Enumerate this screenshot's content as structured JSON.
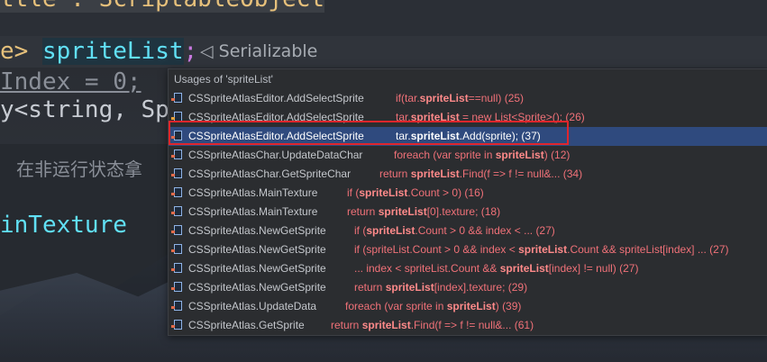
{
  "editor": {
    "line1": "ttle : ScriptableObject",
    "line2_kw": "e> ",
    "line2_ident": "spriteList",
    "line2_semi": ";",
    "serializable": "Serializable",
    "line3": "Index = 0;",
    "line4_gen": "y<string, Spr",
    "comment": "在非运行状态拿",
    "line5": "inTexture",
    "line6": "..."
  },
  "popup": {
    "header": "Usages of 'spriteList'",
    "rows": [
      {
        "location": "CSSpriteAtlasEditor.AddSelectSprite",
        "pre": "if(tar.",
        "hit": "spriteList",
        "post": "==null) (25)",
        "selected": false
      },
      {
        "location": "CSSpriteAtlasEditor.AddSelectSprite",
        "pre": "tar.",
        "hit": "spriteList",
        "post": " = new List<Sprite>(); (26)",
        "selected": false
      },
      {
        "location": "CSSpriteAtlasEditor.AddSelectSprite",
        "pre": "tar.",
        "hit": "spriteList",
        "post": ".Add(sprite); (37)",
        "selected": true
      },
      {
        "location": "CSSpriteAtlasChar.UpdateDataChar",
        "pre": "foreach (var sprite in ",
        "hit": "spriteList",
        "post": ") (12)",
        "selected": false
      },
      {
        "location": "CSSpriteAtlasChar.GetSpriteChar",
        "pre": "return ",
        "hit": "spriteList",
        "post": ".Find(f => f != null&... (34)",
        "selected": false
      },
      {
        "location": "CSSpriteAtlas.MainTexture",
        "pre": "if (",
        "hit": "spriteList",
        "post": ".Count > 0) (16)",
        "selected": false
      },
      {
        "location": "CSSpriteAtlas.MainTexture",
        "pre": "return ",
        "hit": "spriteList",
        "post": "[0].texture; (18)",
        "selected": false
      },
      {
        "location": "CSSpriteAtlas.NewGetSprite",
        "pre": "if (",
        "hit": "spriteList",
        "post": ".Count > 0 && index < ... (27)",
        "selected": false
      },
      {
        "location": "CSSpriteAtlas.NewGetSprite",
        "pre": "if (spriteList.Count > 0 && index < ",
        "hit": "spriteList",
        "post": ".Count && spriteList[index] ... (27)",
        "selected": false
      },
      {
        "location": "CSSpriteAtlas.NewGetSprite",
        "pre": "... index < spriteList.Count && ",
        "hit": "spriteList",
        "post": "[index] != null) (27)",
        "selected": false
      },
      {
        "location": "CSSpriteAtlas.NewGetSprite",
        "pre": "return ",
        "hit": "spriteList",
        "post": "[index].texture; (29)",
        "selected": false
      },
      {
        "location": "CSSpriteAtlas.UpdateData",
        "pre": "foreach (var sprite in ",
        "hit": "spriteList",
        "post": ") (39)",
        "selected": false
      },
      {
        "location": "CSSpriteAtlas.GetSprite",
        "pre": "return ",
        "hit": "spriteList",
        "post": ".Find(f => f != null&... (61)",
        "selected": false
      }
    ]
  }
}
